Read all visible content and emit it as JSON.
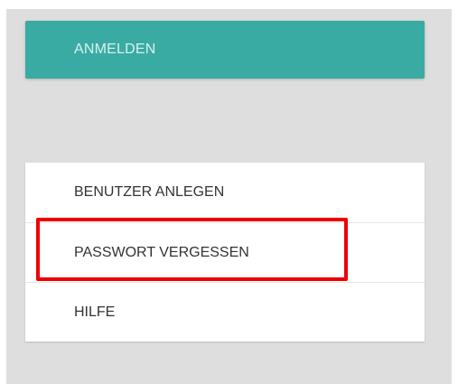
{
  "login": {
    "label": "ANMELDEN"
  },
  "menu": {
    "items": [
      {
        "label": "BENUTZER ANLEGEN"
      },
      {
        "label": "PASSWORT VERGESSEN"
      },
      {
        "label": "HILFE"
      }
    ]
  },
  "colors": {
    "accent": "#3aaba3",
    "accent_text": "#d8f1ee",
    "panel_bg": "#dedede",
    "highlight": "#ee0000"
  }
}
